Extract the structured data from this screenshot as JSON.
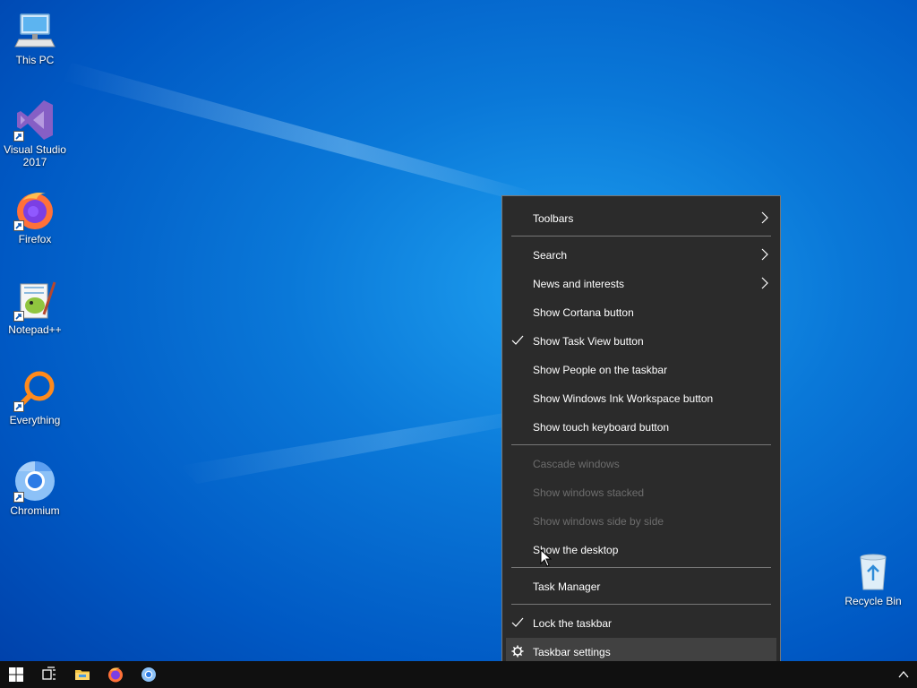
{
  "desktop": {
    "icons": [
      {
        "label": "This PC",
        "icon": "computer-icon"
      },
      {
        "label": "Visual Studio 2017",
        "icon": "visual-studio-icon"
      },
      {
        "label": "Firefox",
        "icon": "firefox-icon"
      },
      {
        "label": "Notepad++",
        "icon": "notepadpp-icon"
      },
      {
        "label": "Everything",
        "icon": "everything-search-icon"
      },
      {
        "label": "Chromium",
        "icon": "chromium-icon"
      },
      {
        "label": "Recycle Bin",
        "icon": "recycle-bin-icon"
      }
    ]
  },
  "context_menu": {
    "items": [
      {
        "label": "Toolbars",
        "submenu": true,
        "checked": false,
        "disabled": false
      },
      {
        "label": "Search",
        "submenu": true,
        "checked": false,
        "disabled": false
      },
      {
        "label": "News and interests",
        "submenu": true,
        "checked": false,
        "disabled": false
      },
      {
        "label": "Show Cortana button",
        "submenu": false,
        "checked": false,
        "disabled": false
      },
      {
        "label": "Show Task View button",
        "submenu": false,
        "checked": true,
        "disabled": false
      },
      {
        "label": "Show People on the taskbar",
        "submenu": false,
        "checked": false,
        "disabled": false
      },
      {
        "label": "Show Windows Ink Workspace button",
        "submenu": false,
        "checked": false,
        "disabled": false
      },
      {
        "label": "Show touch keyboard button",
        "submenu": false,
        "checked": false,
        "disabled": false
      },
      {
        "label": "Cascade windows",
        "submenu": false,
        "checked": false,
        "disabled": true
      },
      {
        "label": "Show windows stacked",
        "submenu": false,
        "checked": false,
        "disabled": true
      },
      {
        "label": "Show windows side by side",
        "submenu": false,
        "checked": false,
        "disabled": true
      },
      {
        "label": "Show the desktop",
        "submenu": false,
        "checked": false,
        "disabled": false
      },
      {
        "label": "Task Manager",
        "submenu": false,
        "checked": false,
        "disabled": false
      },
      {
        "label": "Lock the taskbar",
        "submenu": false,
        "checked": true,
        "disabled": false
      },
      {
        "label": "Taskbar settings",
        "submenu": false,
        "checked": false,
        "disabled": false,
        "icon": "gear-icon",
        "highlighted": true
      }
    ]
  },
  "taskbar": {
    "buttons": [
      "start-icon",
      "task-view-icon",
      "file-explorer-icon",
      "firefox-icon",
      "chromium-icon"
    ],
    "tray": {
      "show_hidden": "chevron-up-icon"
    }
  },
  "colors": {
    "menu_bg": "#2b2b2b",
    "menu_hover": "#414141",
    "disabled_text": "#6d6d6d",
    "taskbar_bg": "#101010",
    "desktop_accent": "#0a78d8"
  }
}
